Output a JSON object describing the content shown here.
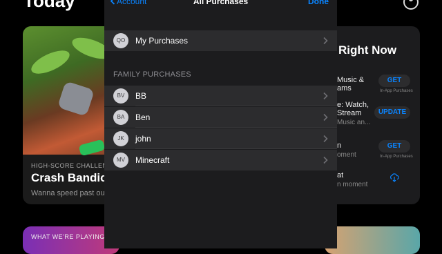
{
  "background": {
    "title": "Today",
    "left_card": {
      "eyebrow": "HIGH-SCORE CHALLEN",
      "headline": "Crash Bandic",
      "subtitle": "Wanna speed past our"
    },
    "right_card": {
      "heading": "Right Now",
      "rows": [
        {
          "line1": "Music &",
          "line2": "ams",
          "button": "GET",
          "iap": "In-App Purchases"
        },
        {
          "line1": "e: Watch,",
          "line1b": "Stream",
          "line2": "Music an...",
          "button": "UPDATE",
          "iap": ""
        },
        {
          "line1": "n",
          "line2": "oment",
          "button": "GET",
          "iap": "In-App Purchases"
        },
        {
          "line1": "at",
          "line2": "n moment",
          "button": "",
          "iap": ""
        }
      ]
    },
    "bottom_left_card": {
      "eyebrow": "WHAT WE'RE PLAYING"
    }
  },
  "sheet": {
    "nav": {
      "back_label": "Account",
      "title": "All Purchases",
      "done_label": "Done"
    },
    "my_purchases": {
      "initials": "QO",
      "label": "My Purchases"
    },
    "family_header": "FAMILY PURCHASES",
    "family": [
      {
        "initials": "BV",
        "name": "BB"
      },
      {
        "initials": "BA",
        "name": "Ben"
      },
      {
        "initials": "JK",
        "name": "john"
      },
      {
        "initials": "MV",
        "name": "Minecraft"
      }
    ]
  },
  "colors": {
    "accent": "#0a84ff",
    "sheet_bg": "#1c1c1e",
    "row_bg": "#2c2c2e",
    "avatar_bg": "#d1d1d6"
  }
}
